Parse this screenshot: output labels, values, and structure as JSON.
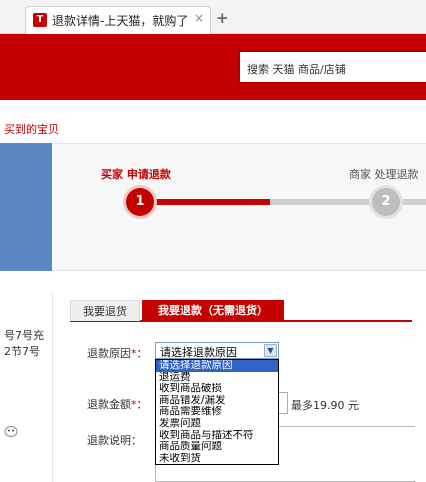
{
  "browser": {
    "tab_title": "退款详情-上天猫，就购了",
    "favicon_letter": "T",
    "close_glyph": "×",
    "newtab_glyph": "+"
  },
  "header": {
    "search_placeholder": "搜索 天猫 商品/店铺"
  },
  "breadcrumb": "买到的宝贝",
  "progress": {
    "steps": [
      {
        "label": "买家 申请退款",
        "number": "1"
      },
      {
        "label": "商家 处理退款",
        "number": "2"
      }
    ]
  },
  "product": {
    "line1": "号7号充",
    "line2": "2节7号"
  },
  "refund_form": {
    "tabs": [
      "我要退货",
      "我要退款（无需退货）"
    ],
    "reason_label": "退款原因",
    "required_mark": "*",
    "amount_label": "退款金额",
    "desc_label": "退款说明",
    "label_colon": "：",
    "select_value": "请选择退款原因",
    "options": [
      "请选择退款原因",
      "退运费",
      "收到商品破损",
      "商品错发/漏发",
      "商品需要维修",
      "发票问题",
      "收到商品与描述不符",
      "商品质量问题",
      "未收到货"
    ],
    "amount_max": "最多19.90 元"
  }
}
